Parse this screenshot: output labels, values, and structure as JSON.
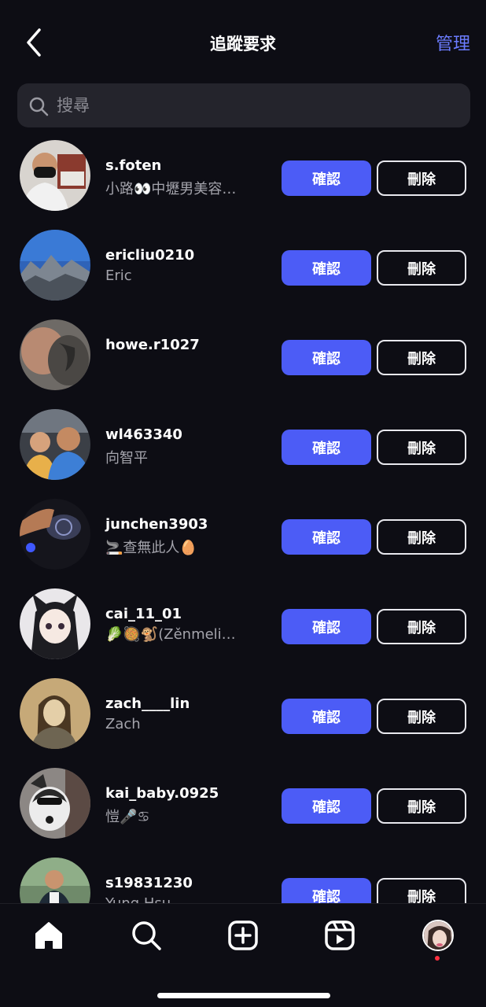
{
  "header": {
    "title": "追蹤要求",
    "manage_label": "管理"
  },
  "search": {
    "placeholder": "搜尋"
  },
  "requests": [
    {
      "username": "s.foten",
      "name": "小路👀中壢男美容…",
      "confirm_label": "確認",
      "delete_label": "刪除"
    },
    {
      "username": "ericliu0210",
      "name": "Eric",
      "confirm_label": "確認",
      "delete_label": "刪除"
    },
    {
      "username": "howe.r1027",
      "name": "",
      "confirm_label": "確認",
      "delete_label": "刪除"
    },
    {
      "username": "wl463340",
      "name": "向智平",
      "confirm_label": "確認",
      "delete_label": "刪除"
    },
    {
      "username": "junchen3903",
      "name": "🚬查無此人🥚",
      "confirm_label": "確認",
      "delete_label": "刪除"
    },
    {
      "username": "cai_11_01",
      "name": "🥬🥘🐒(Zěnmeli…",
      "confirm_label": "確認",
      "delete_label": "刪除"
    },
    {
      "username": "zach____lin",
      "name": "Zach",
      "confirm_label": "確認",
      "delete_label": "刪除"
    },
    {
      "username": "kai_baby.0925",
      "name": "愷🎤♋",
      "confirm_label": "確認",
      "delete_label": "刪除"
    },
    {
      "username": "s19831230",
      "name": "Yung Hsu",
      "confirm_label": "確認",
      "delete_label": "刪除"
    }
  ],
  "tabbar": {
    "icons": [
      "home-icon",
      "search-icon",
      "create-icon",
      "reels-icon",
      "profile-avatar"
    ]
  },
  "colors": {
    "accent": "#4c5cf6",
    "manage": "#6b7cff",
    "background": "#0d0d14",
    "search_bg": "#24242c",
    "notification": "#ff3040"
  }
}
